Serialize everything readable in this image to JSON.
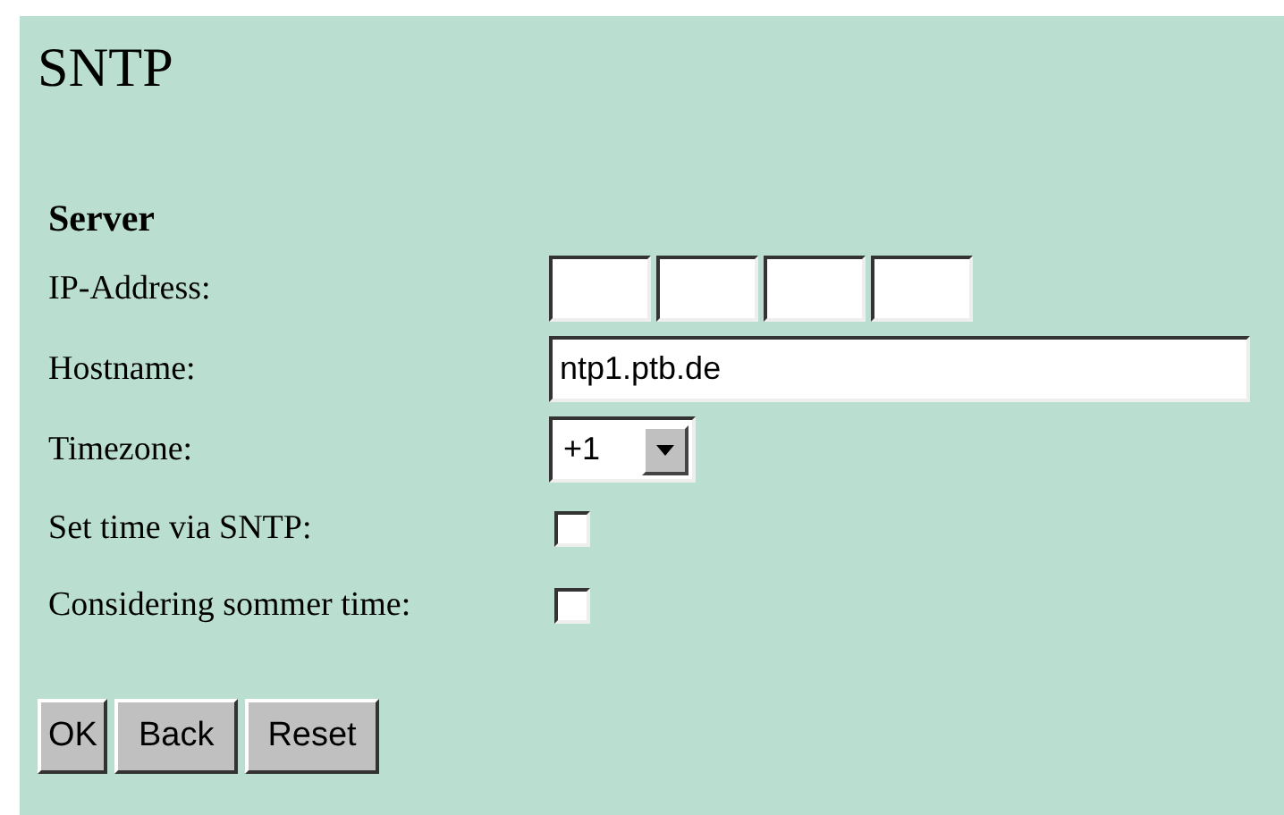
{
  "title": "SNTP",
  "section": "Server",
  "fields": [
    {
      "kind": "ip",
      "label": "IP-Address:"
    },
    {
      "kind": "text",
      "label": "Hostname:",
      "value": "ntp1.ptb.de"
    },
    {
      "kind": "select",
      "label": "Timezone:",
      "value": "+1"
    },
    {
      "kind": "checkbox",
      "label": "Set time via SNTP:",
      "checked": false
    },
    {
      "kind": "checkbox",
      "label": "Considering sommer time:",
      "checked": false
    }
  ],
  "buttons": [
    "OK",
    "Back",
    "Reset"
  ]
}
